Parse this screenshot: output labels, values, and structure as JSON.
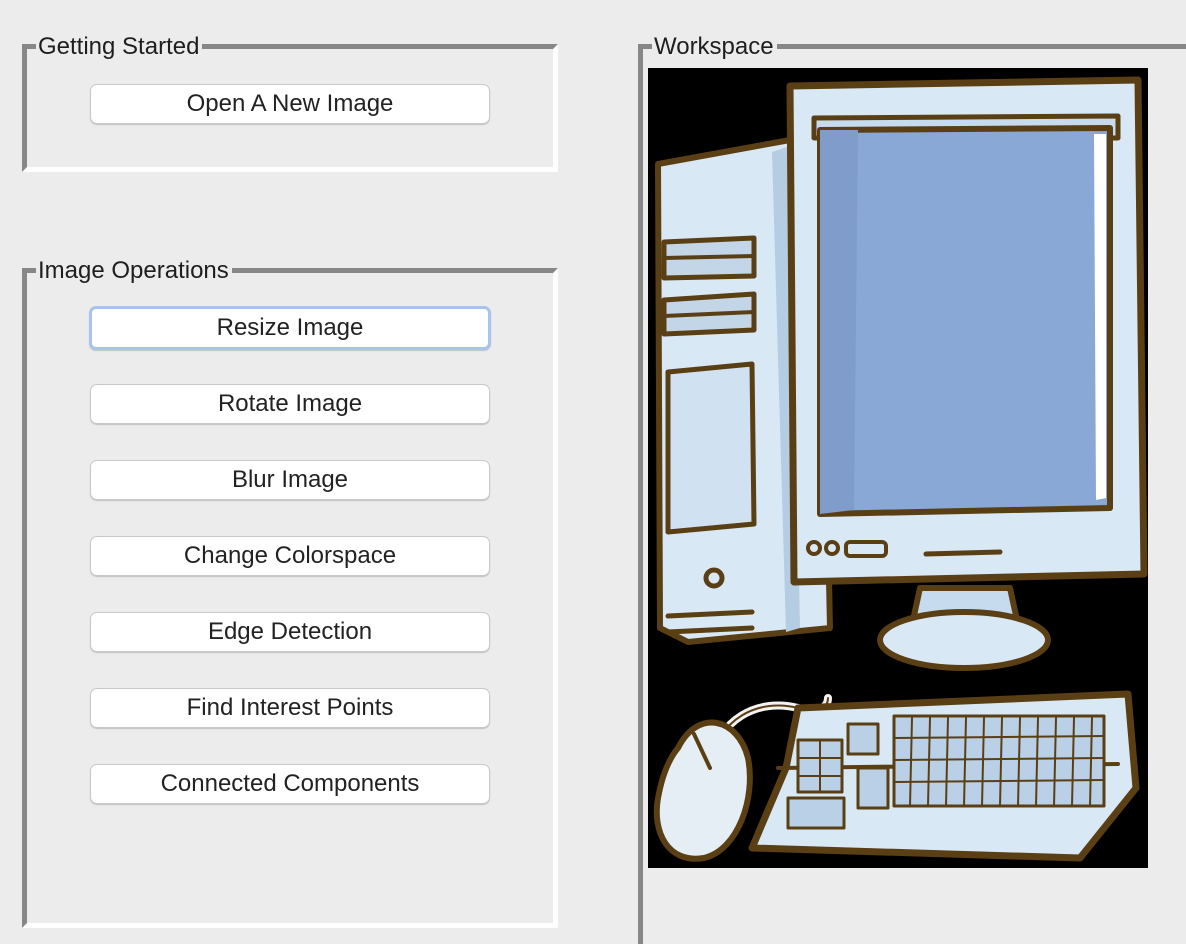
{
  "getting_started": {
    "title": "Getting Started",
    "open_button": "Open A New Image"
  },
  "image_operations": {
    "title": "Image Operations",
    "buttons": [
      {
        "label": "Resize Image",
        "focused": true
      },
      {
        "label": "Rotate Image"
      },
      {
        "label": "Blur Image"
      },
      {
        "label": "Change Colorspace"
      },
      {
        "label": "Edge Detection"
      },
      {
        "label": "Find Interest Points"
      },
      {
        "label": "Connected Components"
      }
    ]
  },
  "workspace": {
    "title": "Workspace",
    "image": "desktop-computer-illustration"
  },
  "colors": {
    "background": "#ececec",
    "border_dark": "#878787",
    "border_light": "#ffffff",
    "focus_ring": "#a6c4ec",
    "computer_body": "#d8e8f5",
    "screen": "#8aa8d6",
    "outline": "#5b3f14"
  }
}
